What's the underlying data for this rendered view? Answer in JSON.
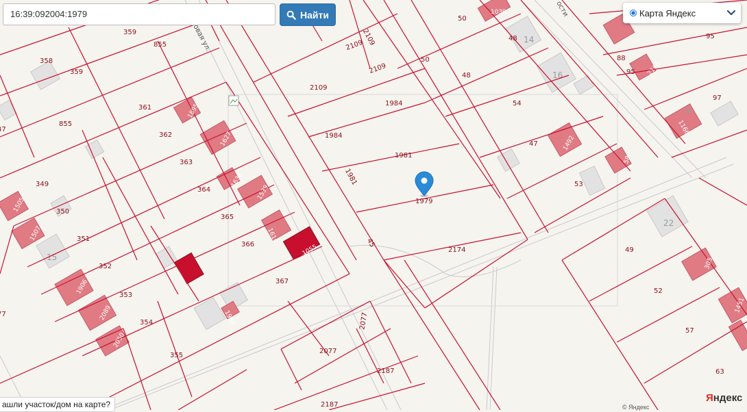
{
  "search": {
    "value": "16:39:092004:1979",
    "button_label": "Найти"
  },
  "layer_selector": {
    "selected": "Карта Яндекс"
  },
  "help_link": "ашли участок/дом на карте?",
  "logo": {
    "first": "Я",
    "rest": "ндекс"
  },
  "copyright": "© Яндекс",
  "street_labels": [
    "овая ул.",
    "ости"
  ],
  "plot_labels": [
    "359",
    "855",
    "359",
    "358",
    "855",
    "361",
    "1895",
    "362",
    "1627",
    "363",
    "1632",
    "364",
    "1539",
    "349",
    "350",
    "351",
    "365",
    "1610",
    "366",
    "1055",
    "352",
    "353",
    "367",
    "354",
    "355",
    "1505",
    "1507",
    "1906",
    "2089",
    "2050",
    "1948",
    "47",
    "77",
    "2109",
    "2109",
    "2109",
    "2109",
    "1984",
    "1984",
    "1981",
    "1981",
    "1979",
    "45",
    "2174",
    "2077",
    "2077",
    "2187",
    "2187",
    "50",
    "1039",
    "48",
    "50",
    "48",
    "54",
    "47",
    "1492",
    "53",
    "580",
    "88",
    "95",
    "2166",
    "95",
    "97",
    "1166",
    "49",
    "52",
    "57",
    "63",
    "305",
    "1451"
  ],
  "house_numbers": [
    "14",
    "16",
    "15",
    "22",
    "9"
  ],
  "marker": {
    "label": "1979",
    "color": "#2a8bd8"
  },
  "colors": {
    "parcel_line": "#c8102e",
    "building": "#e07b84",
    "building_selected": "#c8102e",
    "search_button": "#337ab7"
  }
}
